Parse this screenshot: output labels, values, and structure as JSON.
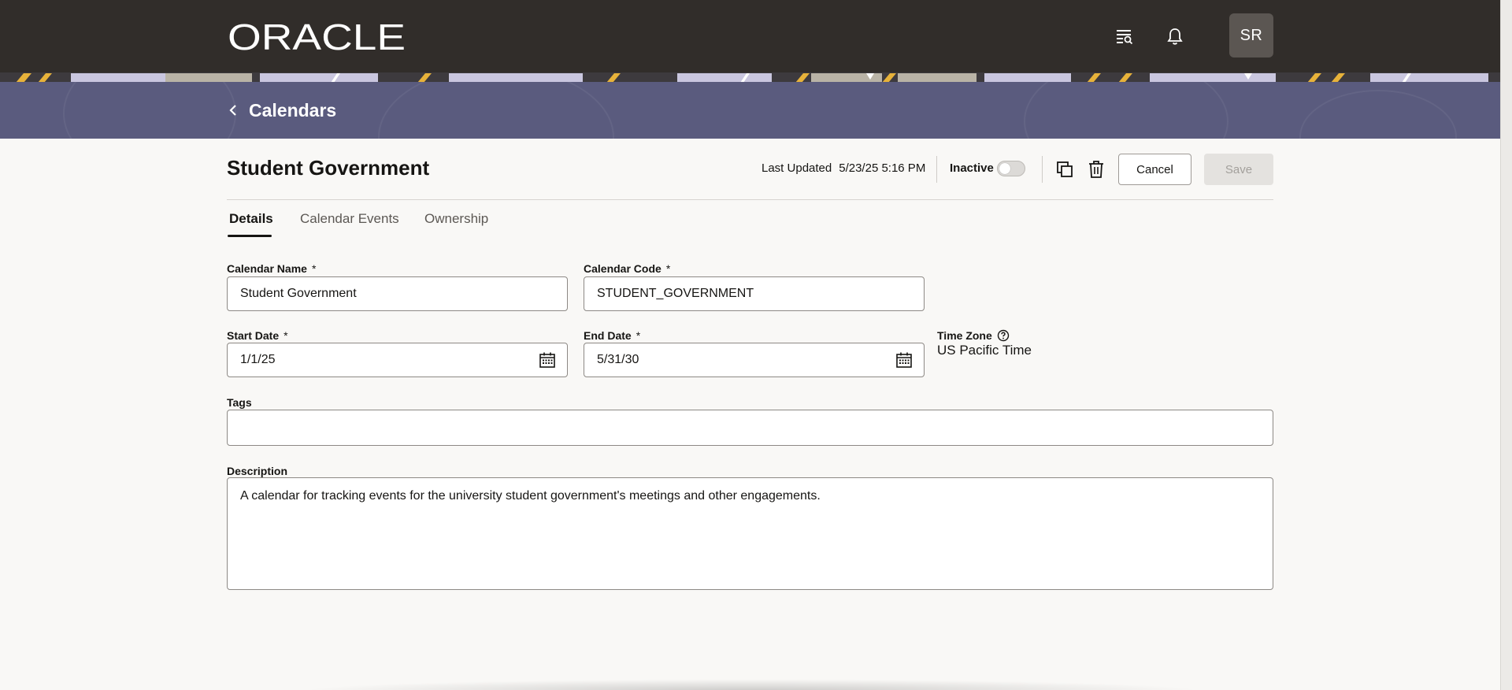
{
  "header": {
    "logo_text": "ORACLE",
    "avatar_initials": "SR"
  },
  "breadcrumb": {
    "back_label": "Calendars"
  },
  "page": {
    "title": "Student Government",
    "last_updated_label": "Last Updated",
    "last_updated_value": "5/23/25 5:16 PM",
    "inactive_label": "Inactive",
    "inactive_on": false,
    "cancel_label": "Cancel",
    "save_label": "Save"
  },
  "tabs": [
    {
      "label": "Details",
      "active": true
    },
    {
      "label": "Calendar Events",
      "active": false
    },
    {
      "label": "Ownership",
      "active": false
    }
  ],
  "form": {
    "calendar_name_label": "Calendar Name",
    "calendar_name_value": "Student Government",
    "calendar_code_label": "Calendar Code",
    "calendar_code_value": "STUDENT_GOVERNMENT",
    "start_date_label": "Start Date",
    "start_date_value": "1/1/25",
    "end_date_label": "End Date",
    "end_date_value": "5/31/30",
    "time_zone_label": "Time Zone",
    "time_zone_value": "US Pacific Time",
    "tags_label": "Tags",
    "tags_value": "",
    "description_label": "Description",
    "description_value": "A calendar for tracking events for the university student government's meetings and other engagements.",
    "required_mark": "*"
  },
  "colors": {
    "topbar": "#312d2a",
    "banner": "#5a5b7e",
    "background": "#f9f8f6"
  }
}
